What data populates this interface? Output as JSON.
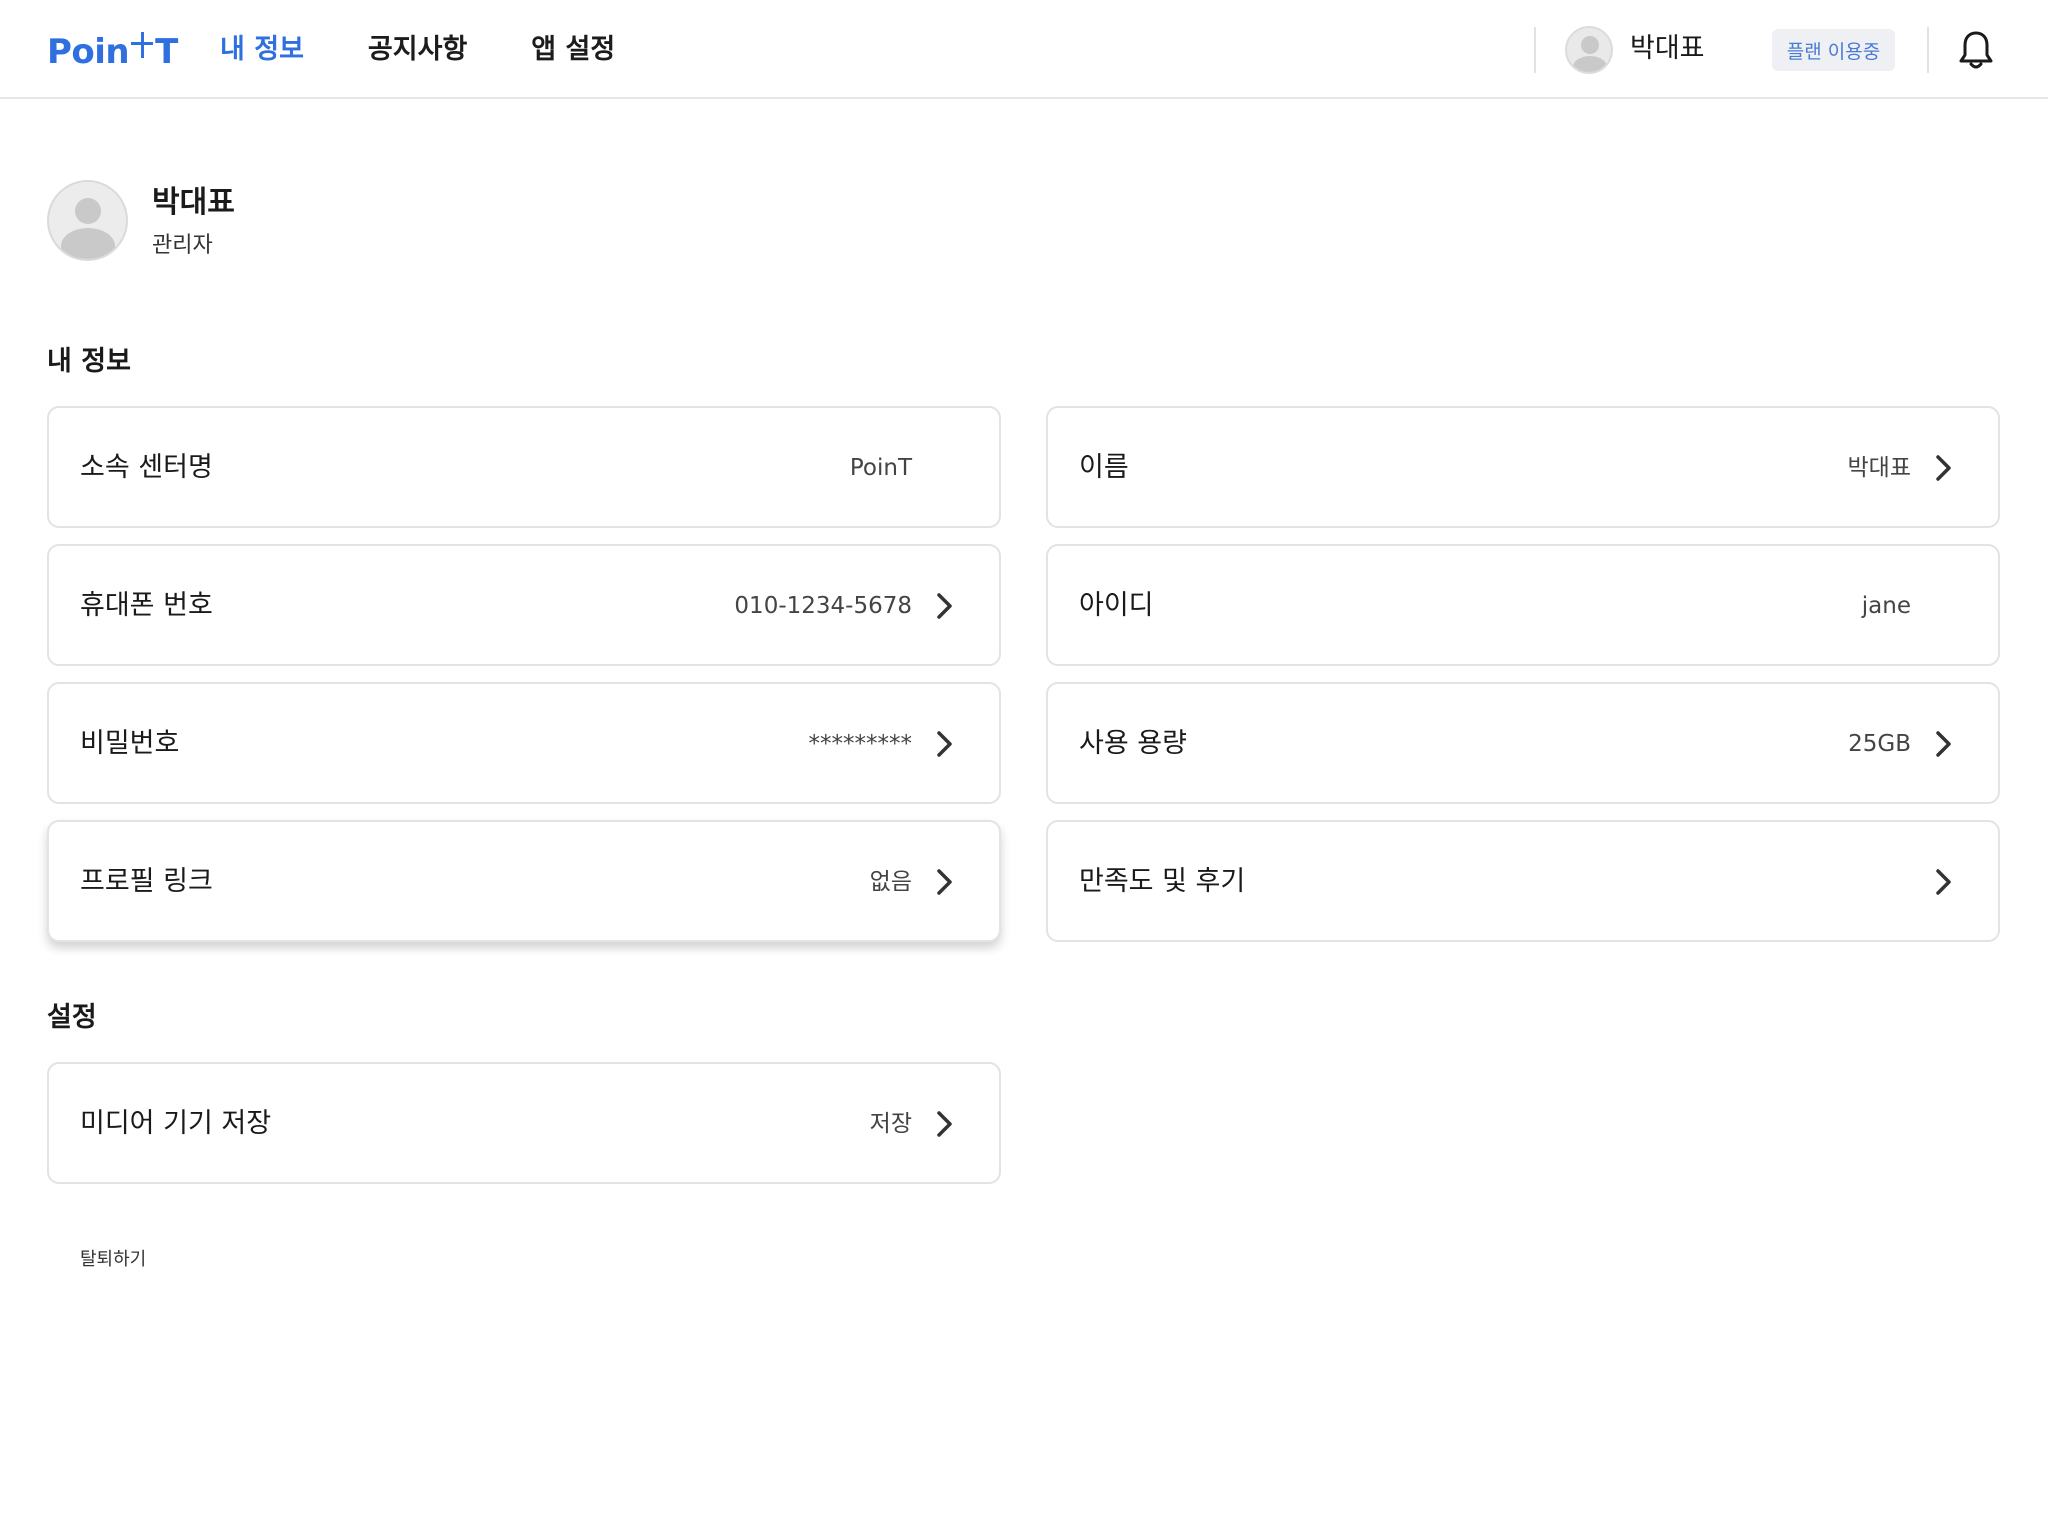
{
  "header": {
    "logo_left": "Poin",
    "logo_right": "T",
    "nav": [
      {
        "label": "내 정보",
        "active": true
      },
      {
        "label": "공지사항",
        "active": false
      },
      {
        "label": "앱 설정",
        "active": false
      }
    ],
    "user_name": "박대표",
    "plan_badge": "플랜 이용중",
    "icons": [
      "user-avatar-icon",
      "bell-icon"
    ]
  },
  "profile": {
    "name": "박대표",
    "role": "관리자"
  },
  "my_info": {
    "title": "내 정보",
    "left": [
      {
        "label": "소속 센터명",
        "value": "PoinT",
        "chevron": false
      },
      {
        "label": "휴대폰 번호",
        "value": "010-1234-5678",
        "chevron": true
      },
      {
        "label": "비밀번호",
        "value": "*********",
        "chevron": true
      },
      {
        "label": "프로필 링크",
        "value": "없음",
        "chevron": true
      }
    ],
    "right": [
      {
        "label": "이름",
        "value": "박대표",
        "chevron": true
      },
      {
        "label": "아이디",
        "value": "jane",
        "chevron": false
      },
      {
        "label": "사용 용량",
        "value": "25GB",
        "chevron": true
      },
      {
        "label": "만족도 및 후기",
        "value": "",
        "chevron": true
      }
    ]
  },
  "settings": {
    "title": "설정",
    "items": [
      {
        "label": "미디어 기기 저장",
        "value": "저장",
        "chevron": true
      }
    ]
  },
  "withdraw_label": "탈퇴하기",
  "colors": {
    "accent": "#2f6fe0",
    "badge_bg": "#eef0f3",
    "badge_text": "#4a7ad6",
    "border": "#e3e3e3"
  }
}
